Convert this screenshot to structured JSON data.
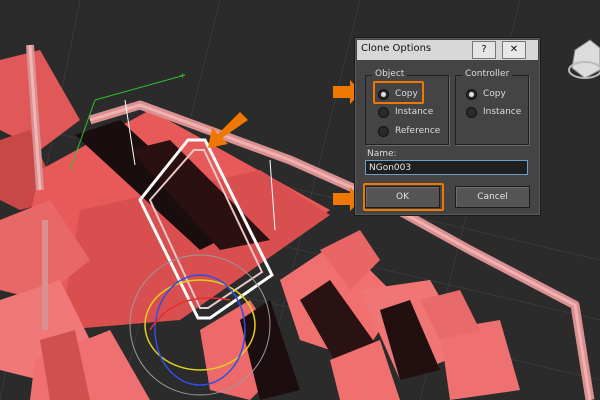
{
  "dialog": {
    "title": "Clone Options",
    "help_label": "?",
    "close_label": "✕",
    "object_group": {
      "label": "Object",
      "options": [
        {
          "label": "Copy",
          "selected": true
        },
        {
          "label": "Instance",
          "selected": false
        },
        {
          "label": "Reference",
          "selected": false
        }
      ]
    },
    "controller_group": {
      "label": "Controller",
      "options": [
        {
          "label": "Copy",
          "selected": true
        },
        {
          "label": "Instance",
          "selected": false
        }
      ]
    },
    "name_label": "Name:",
    "name_value": "NGon003",
    "ok_label": "OK",
    "cancel_label": "Cancel"
  },
  "colors": {
    "viewport_bg": "#2b2b2b",
    "object_red": "#e85a5a",
    "highlight_orange": "#f07800"
  },
  "icons": [
    "arrow-right-icon",
    "arrow-down-left-icon",
    "help-icon",
    "close-icon",
    "viewcube-icon"
  ]
}
